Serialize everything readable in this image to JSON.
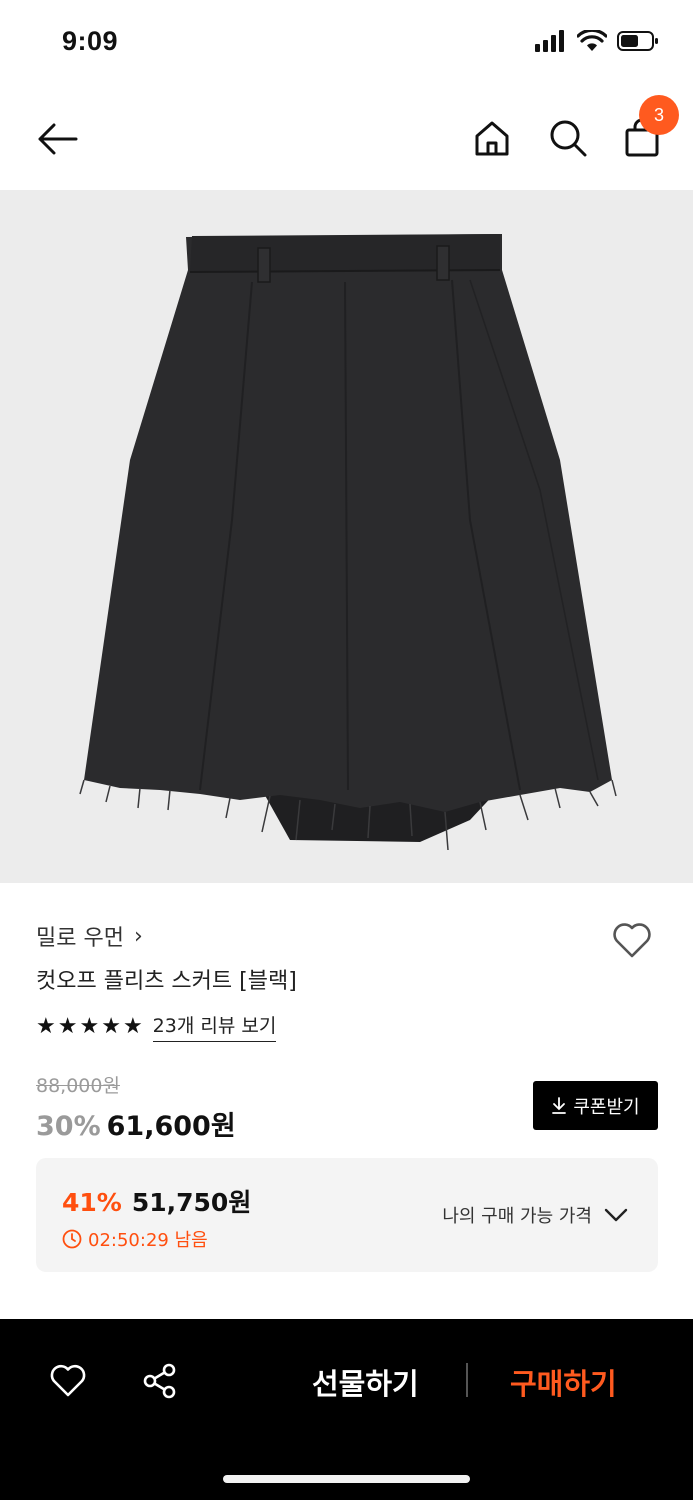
{
  "status_bar": {
    "time": "9:09"
  },
  "header": {
    "cart_count": "3"
  },
  "product": {
    "brand": "밀로 우먼",
    "brand_chevron": "›",
    "name": "컷오프 플리츠 스커트 [블랙]",
    "rating": 5,
    "review_link": "23개 리뷰 보기",
    "original_price": "88,000원",
    "discount": "30%",
    "sale_price": "61,600원",
    "coupon_label": "쿠폰받기"
  },
  "my_price": {
    "discount": "41%",
    "price": "51,750원",
    "timer": "02:50:29 남음",
    "label": "나의 구매 가능 가격"
  },
  "bottom_bar": {
    "gift_label": "선물하기",
    "buy_label": "구매하기"
  },
  "colors": {
    "accent": "#ff5a1f",
    "image_bg": "#ececec",
    "skirt": "#2b2b2d"
  },
  "icons": [
    "back-arrow-icon",
    "home-icon",
    "search-icon",
    "shopping-bag-icon",
    "heart-icon",
    "star-icon",
    "download-icon",
    "clock-icon",
    "chevron-down-icon",
    "share-icon"
  ]
}
